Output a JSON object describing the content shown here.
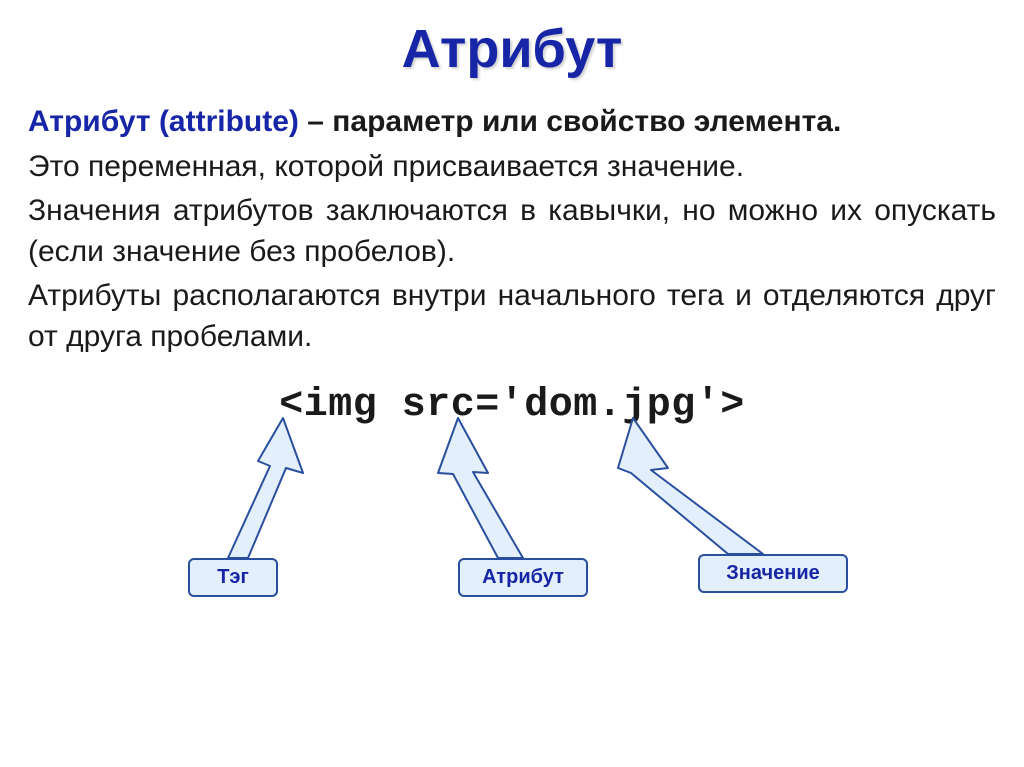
{
  "title": "Атрибут",
  "para1_term": "Атрибут (attribute)",
  "para1_rest": " – параметр или свойство элемента.",
  "para2": "Это переменная, которой присваивается значение.",
  "para3": "Значения атрибутов заключаются в кавычки, но можно их опускать (если значение без пробелов).",
  "para4": "Атрибуты располагаются внутри начального тега и отделяются друг от друга пробелами.",
  "code": "<img src='dom.jpg'>",
  "callouts": {
    "tag": "Тэг",
    "attribute": "Атрибут",
    "value": "Значение"
  }
}
